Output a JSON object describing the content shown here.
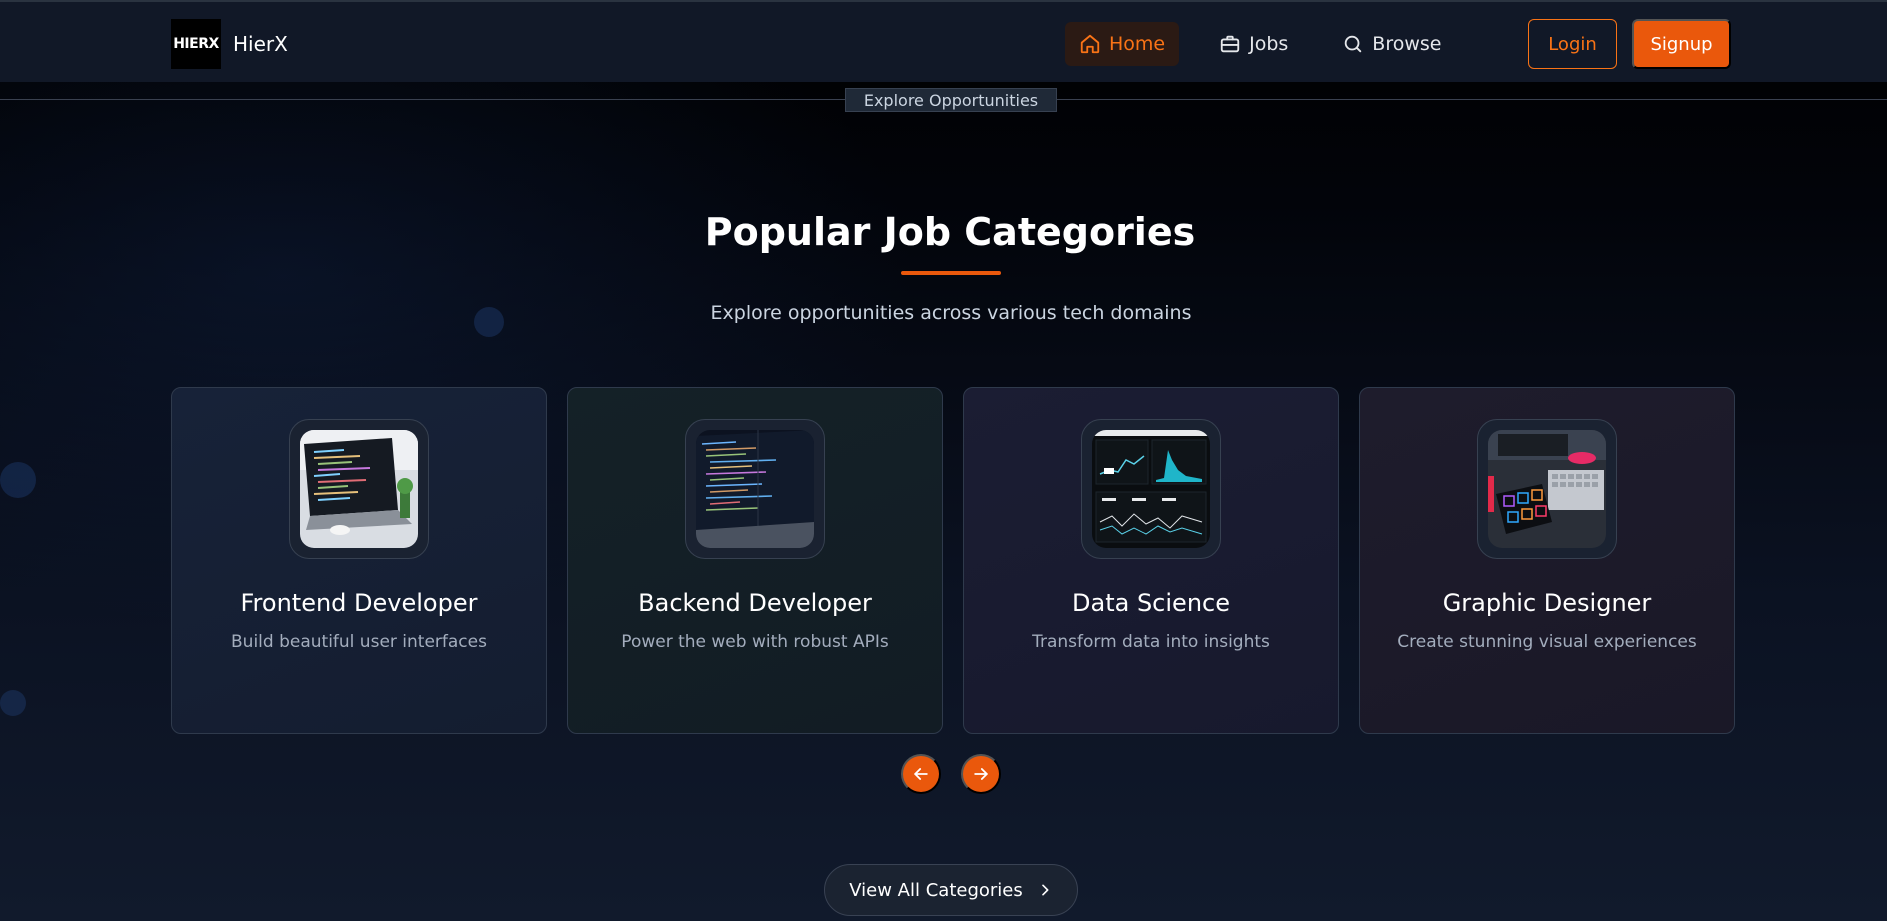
{
  "brand": {
    "logo_text": "HIERX",
    "name": "HierX"
  },
  "nav": {
    "items": [
      {
        "label": "Home",
        "icon": "home-icon",
        "active": true
      },
      {
        "label": "Jobs",
        "icon": "briefcase-icon",
        "active": false
      },
      {
        "label": "Browse",
        "icon": "search-icon",
        "active": false
      }
    ],
    "login_label": "Login",
    "signup_label": "Signup"
  },
  "hero": {
    "tag": "Explore Opportunities",
    "title": "Popular Job Categories",
    "subtitle": "Explore opportunities across various tech domains"
  },
  "categories": [
    {
      "title": "Frontend Developer",
      "desc": "Build beautiful user interfaces",
      "image": "laptop-code-image"
    },
    {
      "title": "Backend Developer",
      "desc": "Power the web with robust APIs",
      "image": "code-screen-image"
    },
    {
      "title": "Data Science",
      "desc": "Transform data into insights",
      "image": "analytics-dashboard-image"
    },
    {
      "title": "Graphic Designer",
      "desc": "Create stunning visual experiences",
      "image": "design-tablet-image"
    }
  ],
  "carousel": {
    "prev_icon": "arrow-left-icon",
    "next_icon": "arrow-right-icon"
  },
  "view_all_label": "View All Categories",
  "colors": {
    "accent": "#ea580c",
    "background": "#0b1120",
    "nav_bg": "#111827"
  }
}
